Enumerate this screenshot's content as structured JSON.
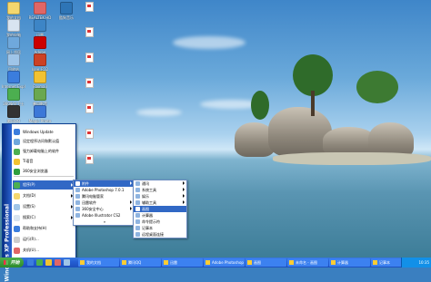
{
  "desktop": {
    "icons": [
      {
        "label": "我的文档",
        "color": "#f5d76e"
      },
      {
        "label": "我的电脑",
        "color": "#d8e4f0"
      },
      {
        "label": "网上邻居",
        "color": "#6fa8dc"
      },
      {
        "label": "回收站",
        "color": "#9fc5e8"
      },
      {
        "label": "Internet Explorer",
        "color": "#3b7ddd"
      },
      {
        "label": "360安全卫士",
        "color": "#4caf50"
      },
      {
        "label": "腾讯QQ",
        "color": "#333333"
      },
      {
        "label": "REALTEK HD",
        "color": "#e06666"
      },
      {
        "label": "迅雷",
        "color": "#3d85c6"
      },
      {
        "label": "Adobe",
        "color": "#cc0000"
      },
      {
        "label": "Isee_R12",
        "color": "#cc4125"
      },
      {
        "label": "Foxmail",
        "color": "#f1c232"
      },
      {
        "label": "暴风影音",
        "color": "#6aa84f"
      },
      {
        "label": "Magic Photo",
        "color": "#3c78d8"
      },
      {
        "label": "酷狗音乐",
        "color": "#2e75b6"
      }
    ],
    "files": [
      "doc1",
      "doc2",
      "doc3",
      "doc4",
      "doc5",
      "doc6",
      "doc7"
    ]
  },
  "start_menu": {
    "banner": "Windows XP Professional",
    "pinned": [
      {
        "label": "Windows Update",
        "color": "#3b7ddd"
      },
      {
        "label": "设定程序访问和默认值",
        "color": "#6fa8dc"
      },
      {
        "label": "强力卸载电脑上的软件",
        "color": "#4caf50"
      },
      {
        "label": "Ti语音",
        "color": "#f1c232"
      },
      {
        "label": "360安全浏览器",
        "color": "#2e9e3e"
      }
    ],
    "items": [
      {
        "label": "程序(P)",
        "color": "#4caf50",
        "arrow": true,
        "highlight": true
      },
      {
        "label": "文档(D)",
        "color": "#f5d76e",
        "arrow": true,
        "highlight": false
      },
      {
        "label": "设置(S)",
        "color": "#9fc5e8",
        "arrow": true,
        "highlight": false
      },
      {
        "label": "搜索(C)",
        "color": "#d8e4f0",
        "arrow": true,
        "highlight": false
      },
      {
        "label": "帮助和支持(H)",
        "color": "#3b7ddd",
        "arrow": false,
        "highlight": false
      },
      {
        "label": "运行(R)...",
        "color": "#cccccc",
        "arrow": false,
        "highlight": false
      },
      {
        "label": "关机(U)...",
        "color": "#e06666",
        "arrow": false,
        "highlight": false
      }
    ]
  },
  "programs_menu": [
    {
      "label": "附件",
      "highlight": true,
      "arrow": true
    },
    {
      "label": "Adobe Photoshop 7.0.1",
      "highlight": false,
      "arrow": false
    },
    {
      "label": "腾讯电脑管家",
      "highlight": false,
      "arrow": false
    },
    {
      "label": "迅雷软件",
      "highlight": false,
      "arrow": true
    },
    {
      "label": "360安全中心",
      "highlight": false,
      "arrow": true
    },
    {
      "label": "Adobe Illustrator CS2",
      "highlight": false,
      "arrow": false
    }
  ],
  "programs_more": "»",
  "accessories_menu": [
    {
      "label": "通讯",
      "highlight": false,
      "arrow": true
    },
    {
      "label": "系统工具",
      "highlight": false,
      "arrow": true
    },
    {
      "label": "娱乐",
      "highlight": false,
      "arrow": true
    },
    {
      "label": "辅助工具",
      "highlight": false,
      "arrow": true
    },
    {
      "label": "画图",
      "highlight": true,
      "arrow": false
    },
    {
      "label": "计算器",
      "highlight": false,
      "arrow": false
    },
    {
      "label": "命令提示符",
      "highlight": false,
      "arrow": false
    },
    {
      "label": "记事本",
      "highlight": false,
      "arrow": false
    },
    {
      "label": "远程桌面连接",
      "highlight": false,
      "arrow": false
    }
  ],
  "taskbar": {
    "start_label": "开始",
    "tasks": [
      "我的文档",
      "腾讯QQ",
      "迅雷",
      "Adobe Photoshop",
      "画图",
      "未命名 - 画图",
      "计算器",
      "记事本"
    ],
    "clock": "10:35"
  }
}
